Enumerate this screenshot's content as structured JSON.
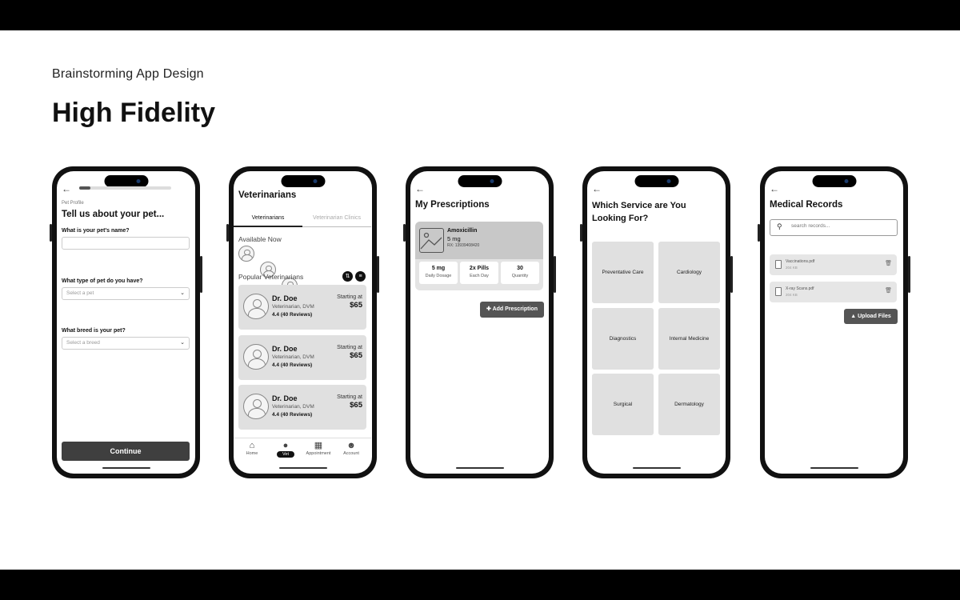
{
  "slide": {
    "subtitle": "Brainstorming App Design",
    "title": "High Fidelity"
  },
  "icons": {
    "back": "arrow-left-icon",
    "chevron": "chevron-down-icon",
    "search": "search-icon",
    "sort": "sort-icon",
    "filter": "filter-icon",
    "image": "image-placeholder-icon",
    "file": "file-icon",
    "trash": "trash-icon",
    "upload": "upload-icon",
    "home": "home-icon",
    "vet": "vet-icon",
    "calendar": "calendar-icon",
    "account": "account-icon"
  },
  "pet_profile": {
    "progress": 0.12,
    "eyebrow": "Pet Profile",
    "heading": "Tell us about your pet...",
    "q_name": "What is your pet's name?",
    "q_type": "What type of pet do you have?",
    "type_placeholder": "Select a pet",
    "q_breed": "What breed is your pet?",
    "breed_placeholder": "Select a breed",
    "continue": "Continue"
  },
  "vets": {
    "heading": "Veterinarians",
    "tabs": [
      "Veterinarians",
      "Veterinarian Clinics"
    ],
    "available_now": "Available Now",
    "popular": "Popular Veterinarians",
    "cards": [
      {
        "name": "Dr. Doe",
        "role": "Veterinarian, DVM",
        "reviews": "4.4 (40 Reviews)",
        "starting": "Starting at",
        "price": "$65"
      },
      {
        "name": "Dr. Doe",
        "role": "Veterinarian, DVM",
        "reviews": "4.4 (40 Reviews)",
        "starting": "Starting at",
        "price": "$65"
      },
      {
        "name": "Dr. Doe",
        "role": "Veterinarian, DVM",
        "reviews": "4.4 (40 Reviews)",
        "starting": "Starting at",
        "price": "$65"
      }
    ],
    "nav": [
      "Home",
      "Vet",
      "Appointment",
      "Account"
    ]
  },
  "prescriptions": {
    "heading": "My Prescriptions",
    "drug": "Amoxicillin",
    "dose": "5 mg",
    "rx": "RX: 13939408420",
    "stats": [
      {
        "value": "5 mg",
        "label": "Daily Dosage"
      },
      {
        "value": "2x Pills",
        "label": "Each Day"
      },
      {
        "value": "30",
        "label": "Quantity"
      }
    ],
    "add_button": "Add Prescription"
  },
  "services": {
    "heading": "Which Service are You Looking For?",
    "items": [
      "Preventative Care",
      "Cardiology",
      "Diagnostics",
      "Internal Medicine",
      "Surgical",
      "Dermatology"
    ]
  },
  "records": {
    "heading": "Medical Records",
    "search_placeholder": "search records...",
    "files": [
      {
        "name": "Vaccinations.pdf",
        "size": "204 KB"
      },
      {
        "name": "X-ray Scans.pdf",
        "size": "204 KB"
      }
    ],
    "upload": "Upload Files"
  }
}
